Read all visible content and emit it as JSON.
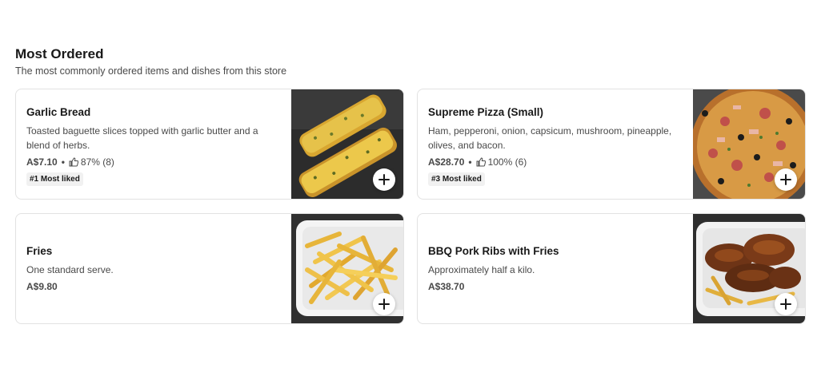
{
  "section": {
    "title": "Most Ordered",
    "subtitle": "The most commonly ordered items and dishes from this store"
  },
  "items": [
    {
      "name": "Garlic Bread",
      "description": "Toasted baguette slices topped with garlic butter and a blend of herbs.",
      "price": "A$7.10",
      "rating": "87% (8)",
      "badge": "#1 Most liked",
      "image_icon": "garlic-bread-photo"
    },
    {
      "name": "Supreme Pizza (Small)",
      "description": "Ham, pepperoni, onion, capsicum, mushroom, pineapple, olives, and bacon.",
      "price": "A$28.70",
      "rating": "100% (6)",
      "badge": "#3 Most liked",
      "image_icon": "pizza-photo"
    },
    {
      "name": "Fries",
      "description": "One standard serve.",
      "price": "A$9.80",
      "image_icon": "fries-photo"
    },
    {
      "name": "BBQ Pork Ribs with Fries",
      "description": "Approximately half a kilo.",
      "price": "A$38.70",
      "image_icon": "ribs-photo"
    }
  ],
  "colors": {
    "text_primary": "#191919",
    "text_secondary": "#494949",
    "card_border": "#e2e2e2",
    "badge_bg": "#f1f1f1"
  }
}
